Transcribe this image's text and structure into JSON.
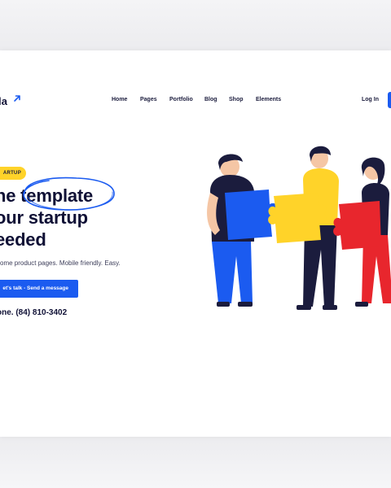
{
  "brand": {
    "name": "la",
    "arrow_icon": "arrow-up-right-icon",
    "accent": "#1b5bf0"
  },
  "nav": {
    "items": [
      "Home",
      "Pages",
      "Portfolio",
      "Blog",
      "Shop",
      "Elements"
    ],
    "login": "Log In"
  },
  "hero": {
    "badge": "ARTUP",
    "headline_1": "he template",
    "headline_2": "our startup",
    "headline_3": "eeded",
    "highlight_word": "template",
    "subtitle": "some product pages. Mobile friendly. Easy.",
    "cta_label": "et's talk - Send a message",
    "phone": "one. (84) 810-3402"
  },
  "colors": {
    "badge": "#ffd329",
    "circle": "#1b5bf0",
    "puzzle_blue": "#1b5bf0",
    "puzzle_yellow": "#ffd329",
    "puzzle_red": "#e8262d",
    "text_dark": "#0f1035"
  }
}
